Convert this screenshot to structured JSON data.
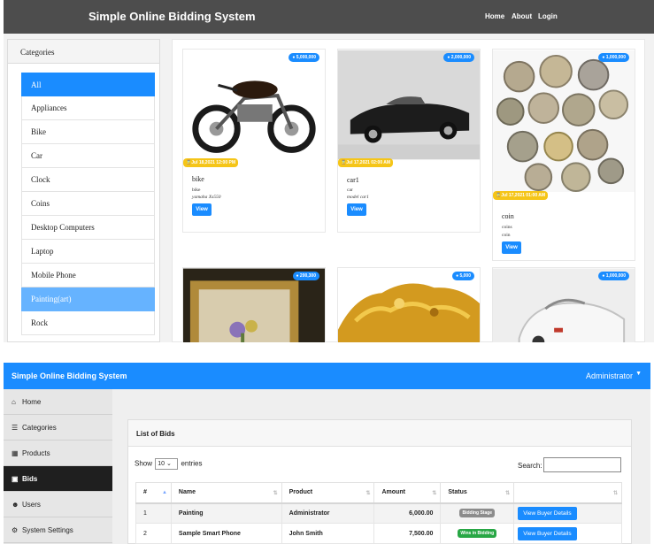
{
  "public_site": {
    "brand": "Simple Online Bidding System",
    "nav": [
      "Home",
      "About",
      "Login"
    ],
    "categories_title": "Categories",
    "categories": [
      {
        "label": "All",
        "state": "active"
      },
      {
        "label": "Appliances",
        "state": "normal"
      },
      {
        "label": "Bike",
        "state": "normal"
      },
      {
        "label": "Car",
        "state": "normal"
      },
      {
        "label": "Clock",
        "state": "normal"
      },
      {
        "label": "Coins",
        "state": "normal"
      },
      {
        "label": "Desktop Computers",
        "state": "normal"
      },
      {
        "label": "Laptop",
        "state": "normal"
      },
      {
        "label": "Mobile Phone",
        "state": "normal"
      },
      {
        "label": "Painting(art)",
        "state": "selected"
      },
      {
        "label": "Rock",
        "state": "normal"
      }
    ],
    "products": [
      {
        "price": "5,000,000",
        "date": "Jul 18,2021 12:00 PM",
        "name": "bike",
        "category": "bike",
        "description": "yamaha Xs550",
        "view": "View"
      },
      {
        "price": "2,000,000",
        "date": "Jul 17,2021 02:00 AM",
        "name": "car1",
        "category": "car",
        "description": "model car1",
        "view": "View"
      },
      {
        "price": "1,000,000",
        "date": "Jul 17,2021 01:00 AM",
        "name": "coin",
        "category": "coins",
        "description": "coin",
        "view": "View"
      },
      {
        "price": "200,300"
      },
      {
        "price": "5,000"
      },
      {
        "price": "1,000,000"
      }
    ]
  },
  "admin": {
    "brand": "Simple Online Bidding System",
    "user": "Administrator",
    "sidebar": [
      {
        "icon": "home-icon",
        "label": "Home"
      },
      {
        "icon": "list-icon",
        "label": "Categories"
      },
      {
        "icon": "table-icon",
        "label": "Products"
      },
      {
        "icon": "money-icon",
        "label": "Bids",
        "active": true
      },
      {
        "icon": "users-icon",
        "label": "Users"
      },
      {
        "icon": "cogs-icon",
        "label": "System Settings"
      }
    ],
    "card_title": "List of Bids",
    "show_prefix": "Show",
    "show_value": "10",
    "show_suffix": "entries",
    "search_label": "Search:",
    "columns": [
      "#",
      "Name",
      "Product",
      "Amount",
      "Status",
      ""
    ],
    "rows": [
      {
        "num": "1",
        "name": "Painting",
        "product": "Administrator",
        "amount": "6,000.00",
        "status": "Bidding Stage",
        "status_color": "#8c8c8c",
        "action": "View Buyer Details"
      },
      {
        "num": "2",
        "name": "Sample Smart Phone",
        "product": "John Smith",
        "amount": "7,500.00",
        "status": "Wins in Bidding",
        "status_color": "#28a745",
        "action": "View Buyer Details"
      }
    ]
  },
  "colors": {
    "primary": "#1a8cff",
    "top_nav": "#4d4d4d",
    "badge_yellow": "#f5c518",
    "sidebar_active": "#1f1f1f"
  }
}
